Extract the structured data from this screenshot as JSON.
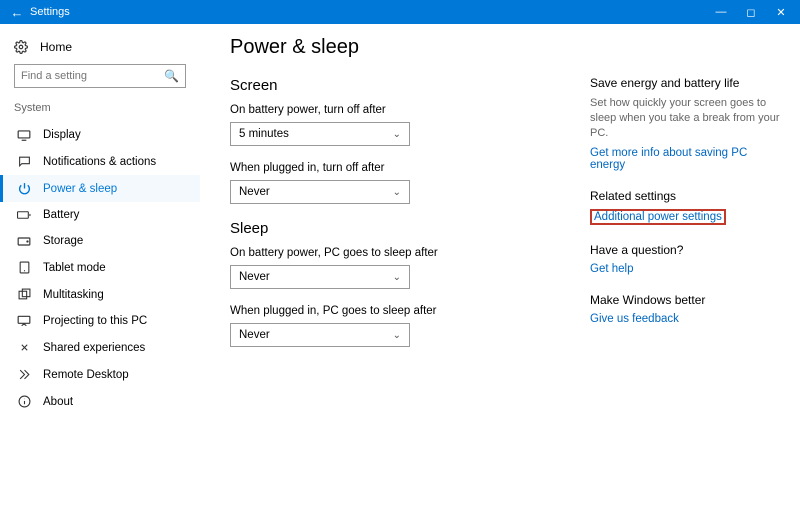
{
  "titlebar": {
    "title": "Settings"
  },
  "sidebar": {
    "home": "Home",
    "search_placeholder": "Find a setting",
    "group": "System",
    "items": [
      {
        "label": "Display"
      },
      {
        "label": "Notifications & actions"
      },
      {
        "label": "Power & sleep"
      },
      {
        "label": "Battery"
      },
      {
        "label": "Storage"
      },
      {
        "label": "Tablet mode"
      },
      {
        "label": "Multitasking"
      },
      {
        "label": "Projecting to this PC"
      },
      {
        "label": "Shared experiences"
      },
      {
        "label": "Remote Desktop"
      },
      {
        "label": "About"
      }
    ]
  },
  "page": {
    "title": "Power & sleep",
    "screen": {
      "heading": "Screen",
      "battery_label": "On battery power, turn off after",
      "battery_value": "5 minutes",
      "plugged_label": "When plugged in, turn off after",
      "plugged_value": "Never"
    },
    "sleep": {
      "heading": "Sleep",
      "battery_label": "On battery power, PC goes to sleep after",
      "battery_value": "Never",
      "plugged_label": "When plugged in, PC goes to sleep after",
      "plugged_value": "Never"
    }
  },
  "rail": {
    "energy_title": "Save energy and battery life",
    "energy_body": "Set how quickly your screen goes to sleep when you take a break from your PC.",
    "energy_link": "Get more info about saving PC energy",
    "related_title": "Related settings",
    "related_link": "Additional power settings",
    "question_title": "Have a question?",
    "question_link": "Get help",
    "feedback_title": "Make Windows better",
    "feedback_link": "Give us feedback"
  }
}
